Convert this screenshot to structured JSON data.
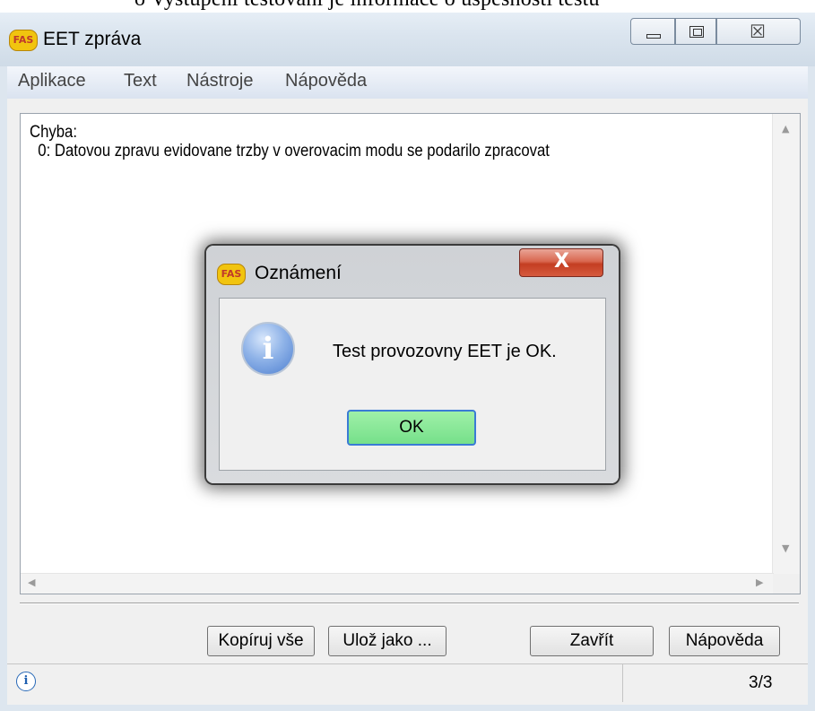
{
  "document": {
    "heading_fragment": "o   Vystupeni testovani je informace o uspesnosti testu"
  },
  "window": {
    "title": "EET zpráva",
    "app_icon": "fas-logo",
    "caption_icons": [
      "minimize-icon",
      "maximize-icon",
      "close-icon"
    ],
    "close_glyph": "☒"
  },
  "menu": [
    {
      "label": "Aplikace"
    },
    {
      "label": "Text"
    },
    {
      "label": "Nástroje"
    },
    {
      "label": "Nápověda"
    }
  ],
  "content": {
    "line1": "Chyba:",
    "line2": "  0: Datovou zpravu evidovane trzby v overovacim modu se podarilo zpracovat"
  },
  "buttons": {
    "copy_all": "Kopíruj vše",
    "save_as": "Ulož jako ...",
    "close": "Zavřít",
    "help": "Nápověda"
  },
  "status": {
    "page": "3/3",
    "icon": "info-icon"
  },
  "dialog": {
    "title": "Oznámení",
    "message": "Test provozovny EET je OK.",
    "ok_label": "OK",
    "close_glyph": "X",
    "colors": {
      "ok_bg": "#8ee89a",
      "close_bg": "#d55a3e"
    }
  }
}
